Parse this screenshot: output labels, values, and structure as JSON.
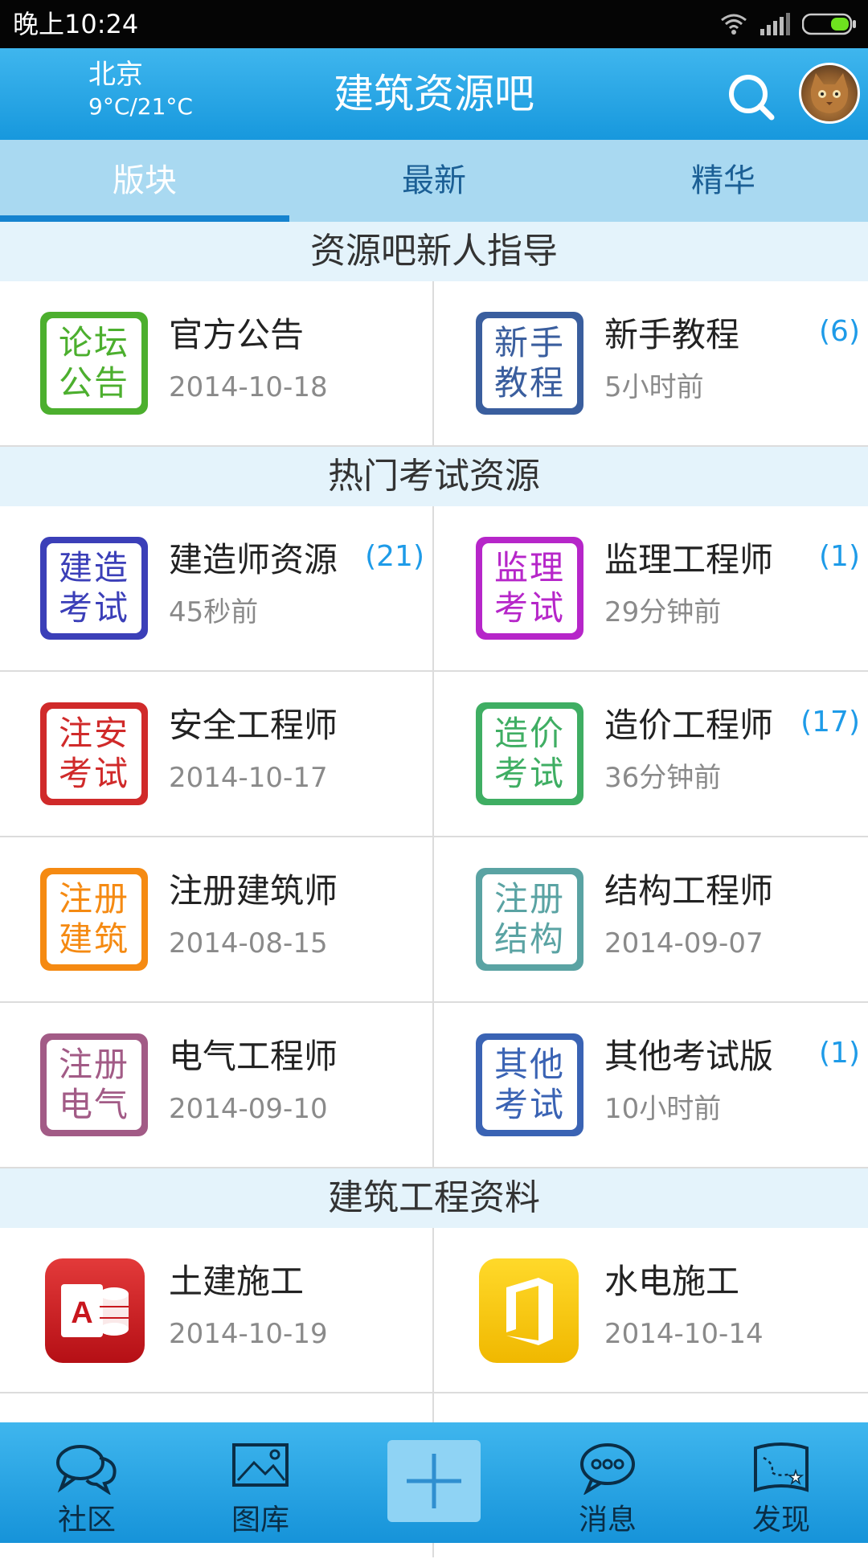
{
  "status_bar": {
    "time": "晚上10:24"
  },
  "header": {
    "city": "北京",
    "temperature": "9°C/21°C",
    "title": "建筑资源吧"
  },
  "tabs": [
    {
      "label": "版块",
      "active": true
    },
    {
      "label": "最新",
      "active": false
    },
    {
      "label": "精华",
      "active": false
    }
  ],
  "sections": [
    {
      "title": "资源吧新人指导",
      "boards": [
        {
          "name": "官方公告",
          "time": "2014-10-18",
          "count": "",
          "icon_text": [
            "论坛",
            "公告"
          ],
          "color": "#4caf2e"
        },
        {
          "name": "新手教程",
          "time": "5小时前",
          "count": "(6)",
          "icon_text": [
            "新手",
            "教程"
          ],
          "color": "#3a5e9e"
        }
      ]
    },
    {
      "title": "热门考试资源",
      "boards": [
        {
          "name": "建造师资源",
          "time": "45秒前",
          "count": "(21)",
          "icon_text": [
            "建造",
            "考试"
          ],
          "color": "#3b3fb8"
        },
        {
          "name": "监理工程师",
          "time": "29分钟前",
          "count": "(1)",
          "icon_text": [
            "监理",
            "考试"
          ],
          "color": "#b626c9"
        },
        {
          "name": "安全工程师",
          "time": "2014-10-17",
          "count": "",
          "icon_text": [
            "注安",
            "考试"
          ],
          "color": "#d02a2a"
        },
        {
          "name": "造价工程师",
          "time": "36分钟前",
          "count": "(17)",
          "icon_text": [
            "造价",
            "考试"
          ],
          "color": "#3fae63"
        },
        {
          "name": "注册建筑师",
          "time": "2014-08-15",
          "count": "",
          "icon_text": [
            "注册",
            "建筑"
          ],
          "color": "#f58a12"
        },
        {
          "name": "结构工程师",
          "time": "2014-09-07",
          "count": "",
          "icon_text": [
            "注册",
            "结构"
          ],
          "color": "#5aa3a3"
        },
        {
          "name": "电气工程师",
          "time": "2014-09-10",
          "count": "",
          "icon_text": [
            "注册",
            "电气"
          ],
          "color": "#a25b86"
        },
        {
          "name": "其他考试版",
          "time": "10小时前",
          "count": "(1)",
          "icon_text": [
            "其他",
            "考试"
          ],
          "color": "#3a63b4"
        }
      ]
    },
    {
      "title": "建筑工程资料",
      "boards": [
        {
          "name": "土建施工",
          "time": "2014-10-19",
          "count": "",
          "icon": "access-app-icon",
          "color": "#c8161d"
        },
        {
          "name": "水电施工",
          "time": "2014-10-14",
          "count": "",
          "icon": "office-app-icon",
          "color": "#f2c200"
        }
      ]
    }
  ],
  "bottom_nav": [
    {
      "label": "社区",
      "icon": "chat-bubbles-icon"
    },
    {
      "label": "图库",
      "icon": "picture-icon"
    },
    {
      "label": "",
      "icon": "plus-icon"
    },
    {
      "label": "消息",
      "icon": "message-icon"
    },
    {
      "label": "发现",
      "icon": "map-icon"
    }
  ]
}
